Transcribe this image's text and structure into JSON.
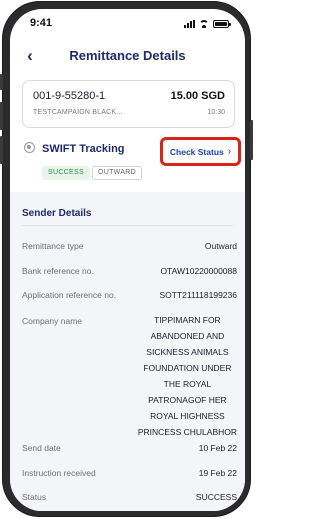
{
  "status_bar": {
    "time": "9:41"
  },
  "header": {
    "back_icon": "chevron-left-icon",
    "back_glyph": "‹",
    "title": "Remittance Details"
  },
  "summary_card": {
    "account": "001-9-55280-1",
    "amount": "15.00 SGD",
    "campaign": "TESTCAMPAIGN BLACK...",
    "time": "10:30"
  },
  "swift": {
    "icon": "swift-globe-icon",
    "title": "SWIFT Tracking",
    "badges": [
      "SUCCESS",
      "OUTWARD"
    ],
    "check_status_label": "Check Status",
    "check_status_chevron": "›"
  },
  "sender_details": {
    "title": "Sender Details",
    "rows": [
      {
        "label": "Remittance type",
        "value": "Outward"
      },
      {
        "label": "Bank reference no.",
        "value": "OTAW10220000088"
      },
      {
        "label": "Application reference no.",
        "value": "SOTT211118199236"
      },
      {
        "label": "Company name",
        "value_lines": [
          "TIPPIMARN FOR",
          "ABANDONED AND",
          "SICKNESS ANIMALS",
          "FOUNDATION UNDER",
          "THE ROYAL",
          "PATRONAGOF HER",
          "ROYAL HIGHNESS",
          "PRINCESS CHULABHOR"
        ]
      },
      {
        "label": "Send date",
        "value": "10 Feb 22"
      },
      {
        "label": "Instruction received",
        "value": "19 Feb 22"
      },
      {
        "label": "Status",
        "value": "SUCCESS"
      }
    ]
  },
  "colors": {
    "brand_navy": "#1d2a6b",
    "link_blue": "#1c3fb8",
    "highlight_red": "#d9241a",
    "success_green": "#2e8b4a"
  }
}
